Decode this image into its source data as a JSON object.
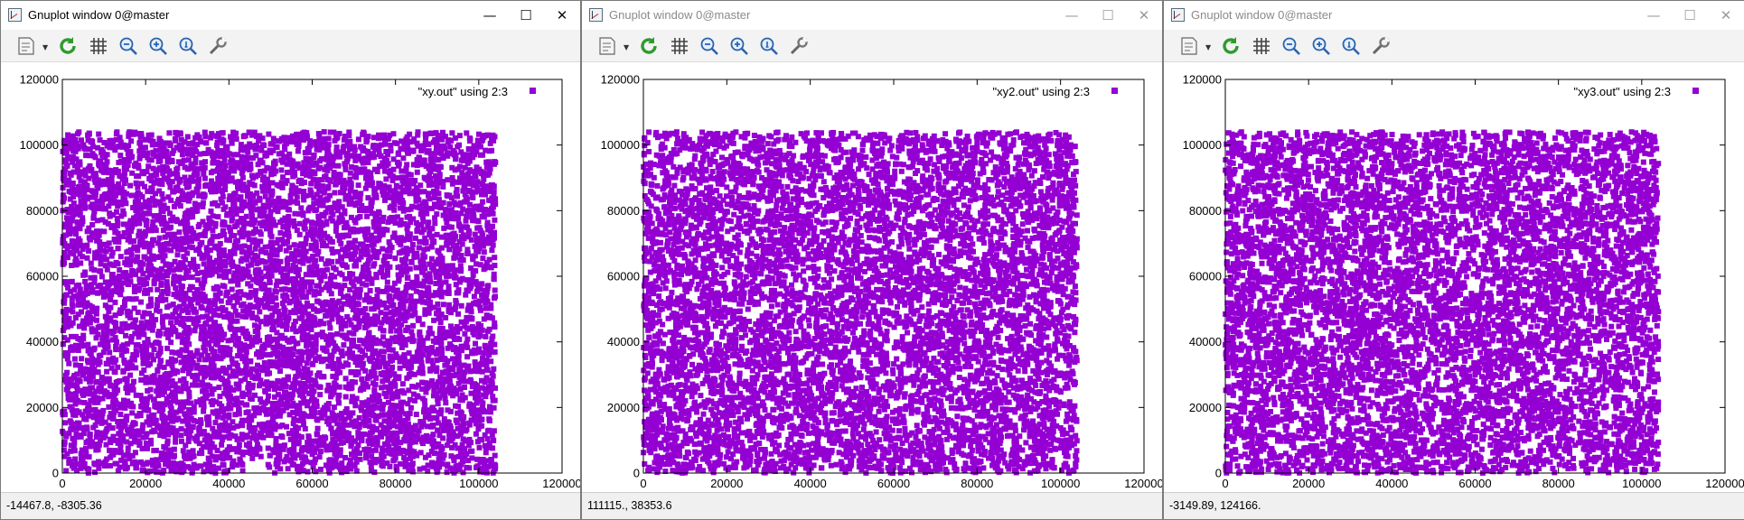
{
  "windows": [
    {
      "title": "Gnuplot window 0@master",
      "active": true,
      "status": "-14467.8, -8305.36",
      "legend": "\"xy.out\" using 2:3"
    },
    {
      "title": "Gnuplot window 0@master",
      "active": false,
      "status": "111115., 38353.6",
      "legend": "\"xy2.out\" using 2:3"
    },
    {
      "title": "Gnuplot window 0@master",
      "active": false,
      "status": "-3149.89, 124166.",
      "legend": "\"xy3.out\" using 2:3"
    }
  ],
  "toolbar": {
    "icons": [
      "options-icon",
      "replot-icon",
      "grid-icon",
      "zoom-previous-icon",
      "zoom-next-icon",
      "autoscale-icon",
      "settings-wrench-icon"
    ]
  },
  "window_controls": {
    "minimize": "—",
    "maximize": "☐",
    "close": "✕"
  },
  "colors": {
    "points": "#9400d3",
    "legend_marker": "#9400d3",
    "replot_green": "#2e9a2e"
  },
  "chart_data": [
    {
      "type": "scatter",
      "title": "",
      "xlabel": "",
      "ylabel": "",
      "xlim": [
        0,
        120000
      ],
      "ylim": [
        0,
        120000
      ],
      "xticks": [
        0,
        20000,
        40000,
        60000,
        80000,
        100000,
        120000
      ],
      "yticks": [
        0,
        20000,
        40000,
        60000,
        80000,
        100000,
        120000
      ],
      "series": [
        {
          "name": "\"xy.out\" using 2:3",
          "x_range": [
            0,
            104000
          ],
          "y_range": [
            0,
            104000
          ],
          "point_count_estimate": 10000,
          "marker": "filled-square"
        }
      ],
      "legend_position": "top-right",
      "grid": false
    },
    {
      "type": "scatter",
      "title": "",
      "xlabel": "",
      "ylabel": "",
      "xlim": [
        0,
        120000
      ],
      "ylim": [
        0,
        120000
      ],
      "xticks": [
        0,
        20000,
        40000,
        60000,
        80000,
        100000,
        120000
      ],
      "yticks": [
        0,
        20000,
        40000,
        60000,
        80000,
        100000,
        120000
      ],
      "series": [
        {
          "name": "\"xy2.out\" using 2:3",
          "x_range": [
            0,
            104000
          ],
          "y_range": [
            0,
            104000
          ],
          "point_count_estimate": 10000,
          "marker": "filled-square"
        }
      ],
      "legend_position": "top-right",
      "grid": false
    },
    {
      "type": "scatter",
      "title": "",
      "xlabel": "",
      "ylabel": "",
      "xlim": [
        0,
        120000
      ],
      "ylim": [
        0,
        120000
      ],
      "xticks": [
        0,
        20000,
        40000,
        60000,
        80000,
        100000,
        120000
      ],
      "yticks": [
        0,
        20000,
        40000,
        60000,
        80000,
        100000,
        120000
      ],
      "series": [
        {
          "name": "\"xy3.out\" using 2:3",
          "x_range": [
            0,
            104000
          ],
          "y_range": [
            0,
            104000
          ],
          "point_count_estimate": 10000,
          "marker": "filled-square"
        }
      ],
      "legend_position": "top-right",
      "grid": false
    }
  ]
}
